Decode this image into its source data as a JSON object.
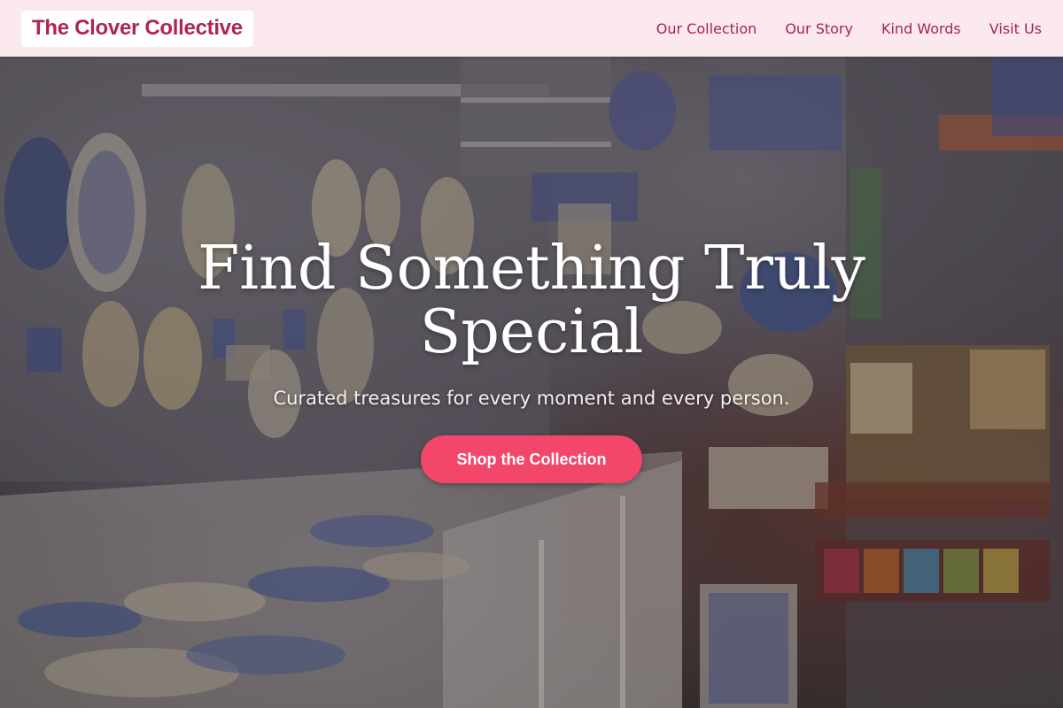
{
  "header": {
    "brand": "The Clover Collective",
    "nav": [
      {
        "label": "Our Collection"
      },
      {
        "label": "Our Story"
      },
      {
        "label": "Kind Words"
      },
      {
        "label": "Visit Us"
      }
    ]
  },
  "hero": {
    "title": "Find Something Truly Special",
    "subtitle": "Curated treasures for every moment and every person.",
    "cta_label": "Shop the Collection",
    "background_image": "ceramics-shop-photo"
  },
  "colors": {
    "brand": "#b0254f",
    "header_bg": "#fbe9ee",
    "cta": "#f2476a",
    "hero_text": "#ffffff"
  }
}
